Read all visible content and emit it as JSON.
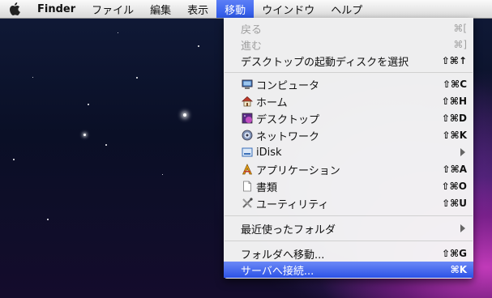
{
  "menubar": {
    "apple_icon": "apple-icon",
    "items": [
      {
        "label": "Finder"
      },
      {
        "label": "ファイル"
      },
      {
        "label": "編集"
      },
      {
        "label": "表示"
      },
      {
        "label": "移動"
      },
      {
        "label": "ウインドウ"
      },
      {
        "label": "ヘルプ"
      }
    ]
  },
  "menu": {
    "back": {
      "label": "戻る",
      "shortcut": "⌘["
    },
    "forward": {
      "label": "進む",
      "shortcut": "⌘]"
    },
    "startup_disk": {
      "label": "デスクトップの起動ディスクを選択",
      "shortcut": "⇧⌘↑"
    },
    "computer": {
      "label": "コンピュータ",
      "shortcut": "⇧⌘C",
      "icon": "computer-icon"
    },
    "home": {
      "label": "ホーム",
      "shortcut": "⇧⌘H",
      "icon": "home-icon"
    },
    "desktop": {
      "label": "デスクトップ",
      "shortcut": "⇧⌘D",
      "icon": "desktop-icon"
    },
    "network": {
      "label": "ネットワーク",
      "shortcut": "⇧⌘K",
      "icon": "network-icon"
    },
    "idisk": {
      "label": "iDisk",
      "icon": "idisk-icon"
    },
    "applications": {
      "label": "アプリケーション",
      "shortcut": "⇧⌘A",
      "icon": "applications-icon"
    },
    "documents": {
      "label": "書類",
      "shortcut": "⇧⌘O",
      "icon": "documents-icon"
    },
    "utilities": {
      "label": "ユーティリティ",
      "shortcut": "⇧⌘U",
      "icon": "utilities-icon"
    },
    "recent_folders": {
      "label": "最近使ったフォルダ"
    },
    "go_to_folder": {
      "label": "フォルダへ移動...",
      "shortcut": "⇧⌘G"
    },
    "connect_server": {
      "label": "サーバへ接続...",
      "shortcut": "⌘K"
    }
  },
  "colors": {
    "highlight": "#3a63ec",
    "menubar_active": "#3a63ec",
    "disabled_text": "#a0a0a0"
  }
}
